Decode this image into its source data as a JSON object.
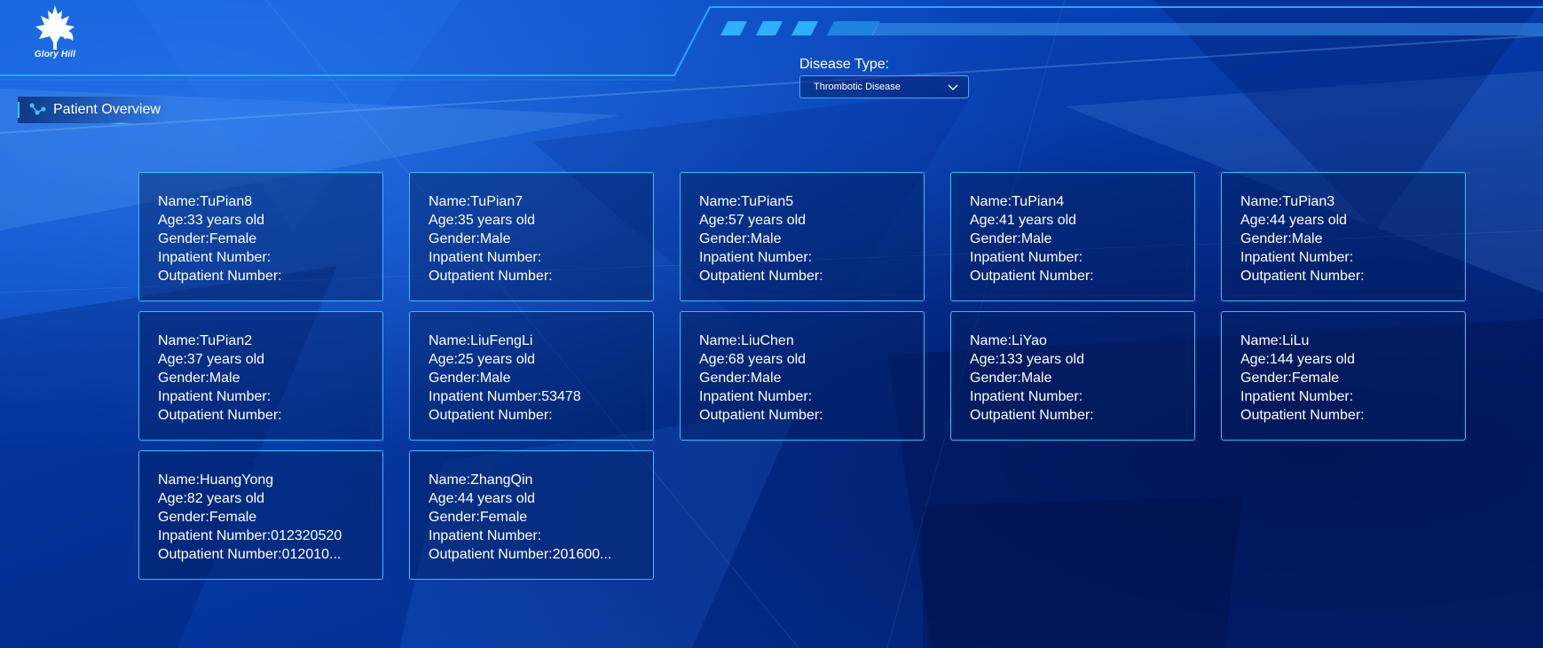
{
  "brand": {
    "logo_text": "Glory Hill"
  },
  "filter": {
    "label": "Disease Type:",
    "selected": "Thrombotic Disease"
  },
  "section": {
    "title": "Patient Overview"
  },
  "colors": {
    "accent": "#29c4ff",
    "text": "#ffffff",
    "background": "#0645b5"
  },
  "patients": [
    {
      "name": "Name:TuPian8",
      "age": "Age:33 years old",
      "gender": "Gender:Female",
      "inpatient": "Inpatient Number:",
      "outpatient": "Outpatient Number:"
    },
    {
      "name": "Name:TuPian7",
      "age": "Age:35 years old",
      "gender": "Gender:Male",
      "inpatient": "Inpatient Number:",
      "outpatient": "Outpatient Number:"
    },
    {
      "name": "Name:TuPian5",
      "age": "Age:57 years old",
      "gender": "Gender:Male",
      "inpatient": "Inpatient Number:",
      "outpatient": "Outpatient Number:"
    },
    {
      "name": "Name:TuPian4",
      "age": "Age:41 years old",
      "gender": "Gender:Male",
      "inpatient": "Inpatient Number:",
      "outpatient": "Outpatient Number:"
    },
    {
      "name": "Name:TuPian3",
      "age": "Age:44 years old",
      "gender": "Gender:Male",
      "inpatient": "Inpatient Number:",
      "outpatient": "Outpatient Number:"
    },
    {
      "name": "Name:TuPian2",
      "age": "Age:37 years old",
      "gender": "Gender:Male",
      "inpatient": "Inpatient Number:",
      "outpatient": "Outpatient Number:"
    },
    {
      "name": "Name:LiuFengLi",
      "age": "Age:25 years old",
      "gender": "Gender:Male",
      "inpatient": "Inpatient Number:53478",
      "outpatient": "Outpatient Number:"
    },
    {
      "name": "Name:LiuChen",
      "age": "Age:68 years old",
      "gender": "Gender:Male",
      "inpatient": "Inpatient Number:",
      "outpatient": "Outpatient Number:"
    },
    {
      "name": "Name:LiYao",
      "age": "Age:133 years old",
      "gender": "Gender:Male",
      "inpatient": "Inpatient Number:",
      "outpatient": "Outpatient Number:"
    },
    {
      "name": "Name:LiLu",
      "age": "Age:144 years old",
      "gender": "Gender:Female",
      "inpatient": "Inpatient Number:",
      "outpatient": "Outpatient Number:"
    },
    {
      "name": "Name:HuangYong",
      "age": "Age:82 years old",
      "gender": "Gender:Female",
      "inpatient": "Inpatient Number:012320520",
      "outpatient": "Outpatient Number:012010..."
    },
    {
      "name": "Name:ZhangQin",
      "age": "Age:44 years old",
      "gender": "Gender:Female",
      "inpatient": "Inpatient Number:",
      "outpatient": "Outpatient Number:201600..."
    }
  ]
}
